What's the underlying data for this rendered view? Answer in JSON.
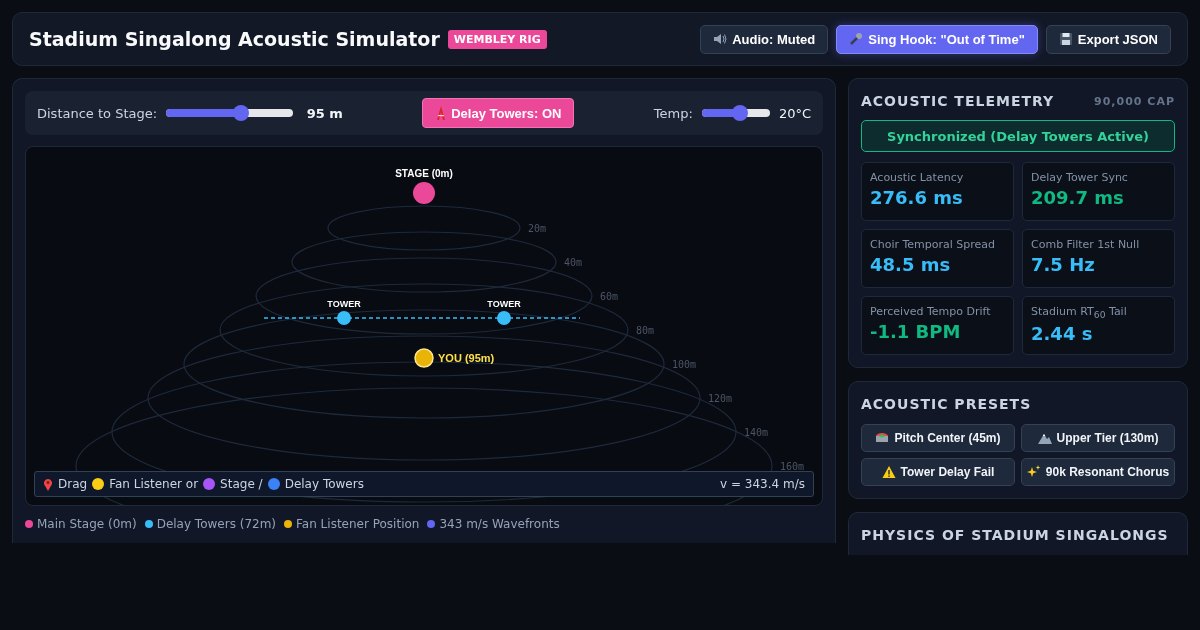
{
  "header": {
    "title": "Stadium Singalong Acoustic Simulator",
    "badge": "WEMBLEY RIG",
    "buttons": [
      {
        "kind": "audio",
        "label": "Audio:",
        "value": "Muted",
        "selected": false
      },
      {
        "kind": "hook",
        "label": "Sing Hook: \"Out of Time\"",
        "selected": true
      },
      {
        "kind": "export",
        "label": "Export JSON",
        "selected": false
      }
    ]
  },
  "controls": {
    "distance": {
      "label": "Distance to Stage:",
      "level": 0.59,
      "reading": "95 m"
    },
    "towers_button": {
      "label": "Delay Towers:",
      "value": "ON",
      "on": true
    },
    "temp": {
      "label": "Temp:",
      "level": 0.56,
      "reading": "20°C"
    }
  },
  "diagram": {
    "stage_label": "STAGE (0m)",
    "tower_labels": [
      "TOWER",
      "TOWER"
    ],
    "listener_label": "YOU (95m)",
    "rings": [
      "20m",
      "40m",
      "60m",
      "80m",
      "100m",
      "120m",
      "140m",
      "160m"
    ],
    "hint": {
      "parts": [
        {
          "kind": "pin"
        },
        {
          "kind": "text",
          "text": "Drag"
        },
        {
          "kind": "dot",
          "color": "#facc15"
        },
        {
          "kind": "text",
          "text": "Fan Listener or"
        },
        {
          "kind": "dot",
          "color": "#a855f7"
        },
        {
          "kind": "text",
          "text": "Stage /"
        },
        {
          "kind": "dot",
          "color": "#3b82f6"
        },
        {
          "kind": "text",
          "text": "Delay Towers"
        }
      ],
      "speed": "v = 343.4 m/s"
    }
  },
  "legend": [
    {
      "label": "Main Stage (0m)",
      "color": "#ec4899"
    },
    {
      "label": "Delay Towers (72m)",
      "color": "#38bdf8"
    },
    {
      "label": "Fan Listener Position",
      "color": "#eab308"
    },
    {
      "label": "343 m/s Wavefronts",
      "color": "#6366f1"
    }
  ],
  "telemetry": {
    "title": "ACOUSTIC TELEMETRY",
    "capacity": "90,000 CAP",
    "status": "Synchronized (Delay Towers Active)",
    "metrics": [
      {
        "label": "Acoustic Latency",
        "value": "276.6 ms",
        "color": "#38bdf8"
      },
      {
        "label": "Delay Tower Sync",
        "value": "209.7 ms",
        "color": "#10b981"
      },
      {
        "label": "Choir Temporal Spread",
        "value": "48.5 ms",
        "color": "#38bdf8"
      },
      {
        "label": "Comb Filter 1st Null",
        "value": "7.5 Hz",
        "color": "#38bdf8"
      },
      {
        "label": "Perceived Tempo Drift",
        "value": "-1.1 BPM",
        "color": "#10b981"
      },
      {
        "label": "Stadium RT$_{60}$ Tail",
        "value": "2.44 s",
        "color": "#38bdf8"
      }
    ]
  },
  "presets": {
    "title": "ACOUSTIC PRESETS",
    "items": [
      {
        "kind": "stadium",
        "label": "Pitch Center (45m)"
      },
      {
        "kind": "mountain",
        "label": "Upper Tier (130m)"
      },
      {
        "kind": "warning",
        "label": "Tower Delay Fail"
      },
      {
        "kind": "sparkles",
        "label": "90k Resonant Chorus"
      }
    ]
  },
  "physics": {
    "title": "PHYSICS OF STADIUM SINGALONGS"
  }
}
